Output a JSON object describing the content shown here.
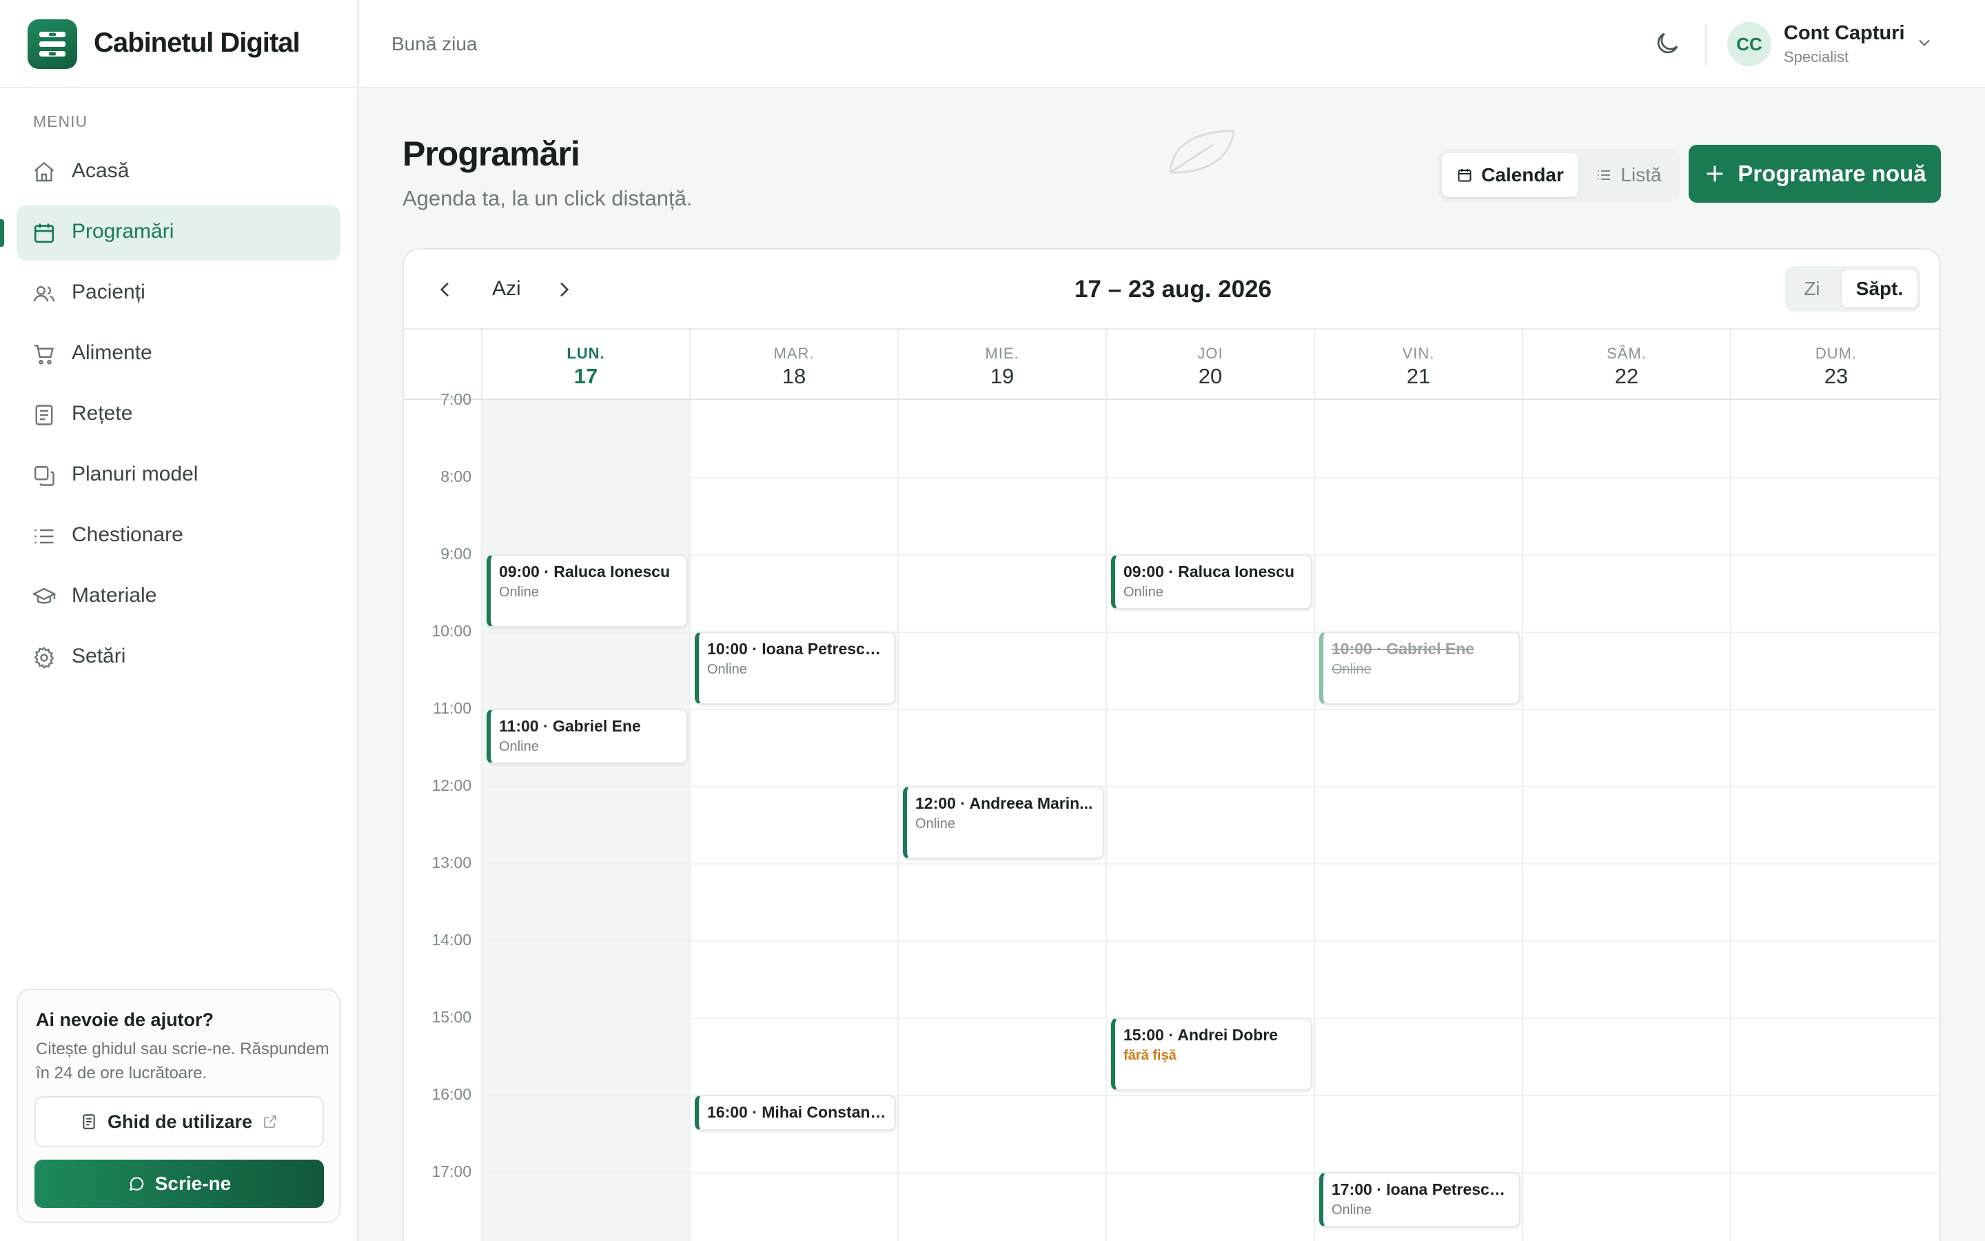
{
  "brand": {
    "name": "Cabinetul Digital"
  },
  "sidebar": {
    "menu_label": "MENIU",
    "items": [
      {
        "label": "Acasă",
        "icon": "home-icon"
      },
      {
        "label": "Programări",
        "icon": "calendar-icon",
        "active": true
      },
      {
        "label": "Pacienți",
        "icon": "users-icon"
      },
      {
        "label": "Alimente",
        "icon": "cart-icon"
      },
      {
        "label": "Rețete",
        "icon": "recipe-icon"
      },
      {
        "label": "Planuri model",
        "icon": "copy-icon"
      },
      {
        "label": "Chestionare",
        "icon": "list-icon"
      },
      {
        "label": "Materiale",
        "icon": "graduation-cap-icon"
      },
      {
        "label": "Setări",
        "icon": "gear-icon"
      }
    ],
    "help": {
      "title": "Ai nevoie de ajutor?",
      "text": "Citește ghidul sau scrie-ne. Răspundem în 24 de ore lucrătoare.",
      "guide_label": "Ghid de utilizare",
      "write_label": "Scrie-ne"
    }
  },
  "topbar": {
    "greeting": "Bună ziua",
    "account": {
      "initials": "CC",
      "name": "Cont Capturi",
      "role": "Specialist"
    }
  },
  "header": {
    "title": "Programări",
    "subtitle": "Agenda ta, la un click distanță.",
    "view_calendar": "Calendar",
    "view_list": "Listă",
    "new_button": "Programare nouă"
  },
  "calendar": {
    "today_label": "Azi",
    "range": "17 – 23 aug. 2026",
    "zoom_day": "Zi",
    "zoom_week": "Săpt.",
    "days": [
      {
        "name": "LUN.",
        "date": "17",
        "today": true
      },
      {
        "name": "MAR.",
        "date": "18"
      },
      {
        "name": "MIE.",
        "date": "19"
      },
      {
        "name": "JOI",
        "date": "20"
      },
      {
        "name": "VIN.",
        "date": "21"
      },
      {
        "name": "SÂM.",
        "date": "22"
      },
      {
        "name": "DUM.",
        "date": "23"
      }
    ],
    "hours": [
      "7:00",
      "8:00",
      "9:00",
      "10:00",
      "11:00",
      "12:00",
      "13:00",
      "14:00",
      "15:00",
      "16:00",
      "17:00"
    ],
    "events": [
      {
        "title": "09:00 · Raluca Ionescu",
        "sub": "Online"
      },
      {
        "title": "11:00 · Gabriel Ene",
        "sub": "Online"
      },
      {
        "title": "10:00 · Ioana Petrescu...",
        "sub": "Online"
      },
      {
        "title": "16:00 · Mihai Constant...",
        "sub": ""
      },
      {
        "title": "12:00 · Andreea Marin...",
        "sub": "Online"
      },
      {
        "title": "09:00 · Raluca Ionescu",
        "sub": "Online"
      },
      {
        "title": "15:00 · Andrei Dobre",
        "sub": "fără fișă"
      },
      {
        "title": "10:00 · Gabriel Ene",
        "sub": "Online",
        "cancelled": true
      },
      {
        "title": "17:00 · Ioana Petrescu...",
        "sub": "Online"
      }
    ]
  },
  "colors": {
    "accent": "#1a7a52",
    "warning": "#d47a12"
  }
}
